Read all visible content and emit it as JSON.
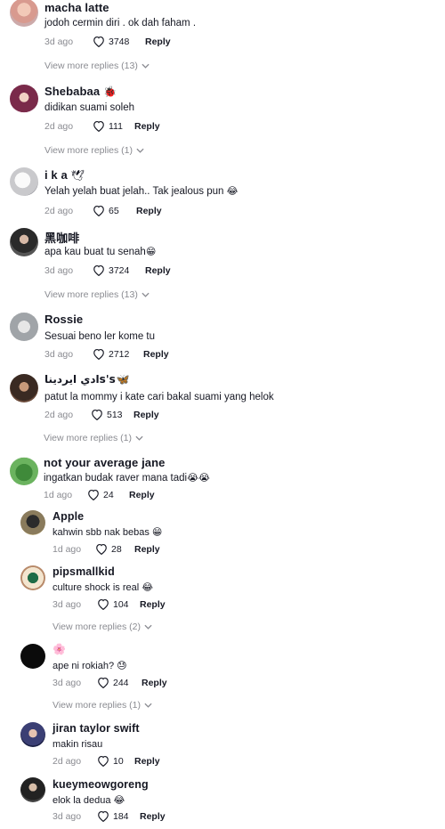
{
  "comments": [
    {
      "username": "macha latte",
      "text": "jodoh cermin diri . ok dah faham .",
      "age": "3d ago",
      "likes": "3748",
      "reply": "Reply",
      "view_more": "View more replies (13)"
    },
    {
      "username": "Shebabaa",
      "username_emoji": "🐞",
      "text": "didikan suami soleh",
      "age": "2d ago",
      "likes": "111",
      "reply": "Reply",
      "view_more": "View more replies (1)"
    },
    {
      "username": "i k a",
      "username_emoji": "🕊",
      "text": "Yelah yelah buat jelah.. Tak jealous pun",
      "text_emoji": "😂",
      "age": "2d ago",
      "likes": "65",
      "reply": "Reply"
    },
    {
      "username": "黑咖啡",
      "text": "apa kau buat tu senah",
      "text_emoji": "😁",
      "age": "3d ago",
      "likes": "3724",
      "reply": "Reply",
      "view_more": "View more replies (13)"
    },
    {
      "username": "Rossie",
      "text": "Sesuai beno ler kome tu",
      "age": "3d ago",
      "likes": "2712",
      "reply": "Reply"
    },
    {
      "username": "ادي ايرديناs's",
      "username_emoji": "🦋",
      "text": "patut la mommy i kate cari bakal suami yang helok",
      "age": "2d ago",
      "likes": "513",
      "reply": "Reply",
      "view_more": "View more replies (1)"
    },
    {
      "username": "not your average jane",
      "text": "ingatkan budak raver mana tadi",
      "text_emoji": "😭😭",
      "age": "1d ago",
      "likes": "24",
      "reply": "Reply"
    }
  ],
  "replies": [
    {
      "username": "Apple",
      "text": "kahwin sbb nak bebas",
      "text_emoji": "😁",
      "age": "1d ago",
      "likes": "28",
      "reply": "Reply"
    },
    {
      "username": "pipsmallkid",
      "text": "culture shock is real",
      "text_emoji": "😂",
      "age": "3d ago",
      "likes": "104",
      "reply": "Reply",
      "view_more": "View more replies (2)"
    },
    {
      "username": "",
      "username_emoji": "🌸",
      "text": "ape ni rokiah?",
      "text_emoji": "😓",
      "age": "3d ago",
      "likes": "244",
      "reply": "Reply",
      "view_more": "View more replies (1)"
    },
    {
      "username": "jiran taylor swift",
      "text": "makin risau",
      "age": "2d ago",
      "likes": "10",
      "reply": "Reply"
    },
    {
      "username": "kueymeowgoreng",
      "text": "elok la dedua",
      "text_emoji": "😂",
      "age": "3d ago",
      "likes": "184",
      "reply": "Reply"
    }
  ],
  "colors": {
    "meta": "#8a8b91",
    "text": "#161823"
  }
}
